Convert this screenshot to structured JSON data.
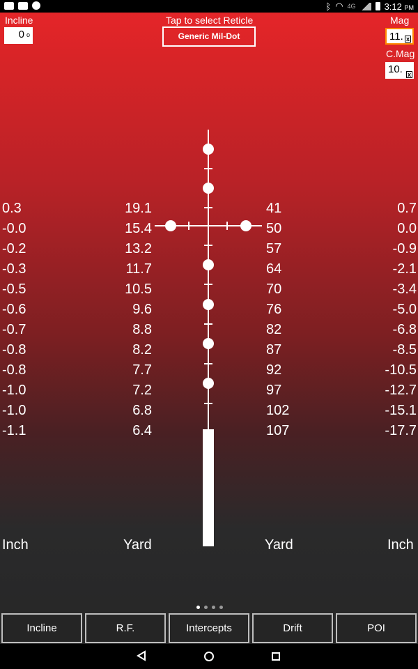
{
  "status_bar": {
    "time": "3:12",
    "ampm": "PM",
    "network": "4G",
    "icons": [
      "notification-icon",
      "wifi-app-icon",
      "chat-icon",
      "bluetooth-icon",
      "wifi-icon",
      "signal-icon",
      "battery-icon"
    ]
  },
  "header": {
    "incline_label": "Incline",
    "incline_value": "0",
    "incline_unit": "o",
    "reticle_hint": "Tap to select Reticle",
    "reticle_name": "Generic Mil-Dot",
    "mag_label": "Mag",
    "mag_value": "11.",
    "cmag_label": "C.Mag",
    "cmag_value": "10.",
    "clear_glyph": "x"
  },
  "table": {
    "col1": [
      "0.3",
      "-0.0",
      "-0.2",
      "-0.3",
      "-0.5",
      "-0.6",
      "-0.7",
      "-0.8",
      "-0.8",
      "-1.0",
      "-1.0",
      "-1.1"
    ],
    "col2": [
      "19.1",
      "15.4",
      "13.2",
      "11.7",
      "10.5",
      "9.6",
      "8.8",
      "8.2",
      "7.7",
      "7.2",
      "6.8",
      "6.4"
    ],
    "col3": [
      "41",
      "50",
      "57",
      "64",
      "70",
      "76",
      "82",
      "87",
      "92",
      "97",
      "102",
      "107"
    ],
    "col4": [
      "0.7",
      "0.0",
      "-0.9",
      "-2.1",
      "-3.4",
      "-5.0",
      "-6.8",
      "-8.5",
      "-10.5",
      "-12.7",
      "-15.1",
      "-17.7"
    ]
  },
  "units": {
    "left_inch": "Inch",
    "left_yard": "Yard",
    "right_yard": "Yard",
    "right_inch": "Inch"
  },
  "pager": {
    "count": 4,
    "active": 0
  },
  "buttons": [
    "Incline",
    "R.F.",
    "Intercepts",
    "Drift",
    "POI"
  ],
  "colors": {
    "accent": "#ff8a00",
    "gradient_top": "#e8262a",
    "gradient_bottom": "#262626"
  }
}
